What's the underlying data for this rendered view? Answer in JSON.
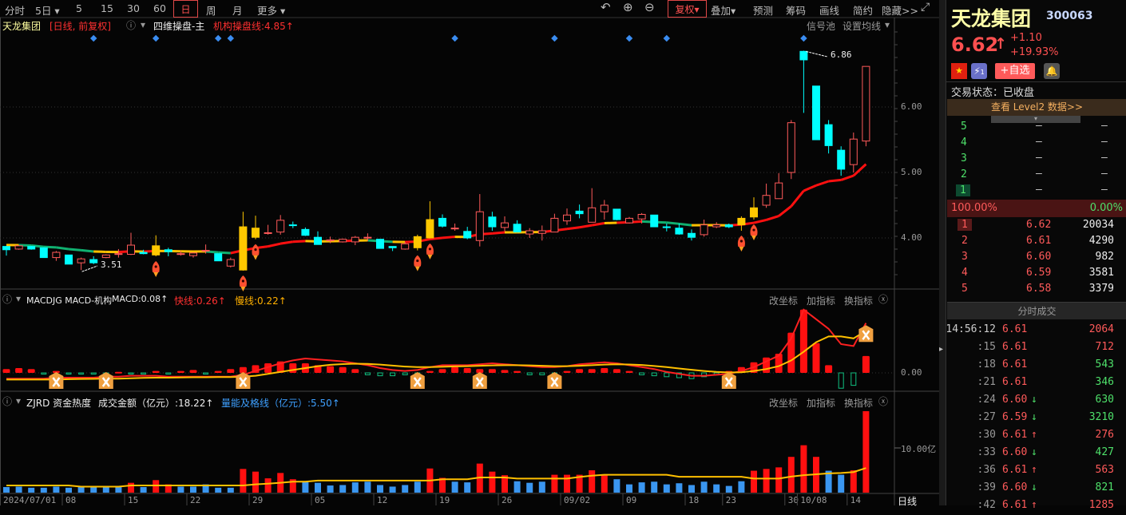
{
  "toolbar": {
    "periods": [
      "分时",
      "5日",
      "5",
      "15",
      "30",
      "60",
      "日",
      "周",
      "月",
      "更多"
    ],
    "selected_period": "日",
    "right": [
      "复权",
      "叠加",
      "预测",
      "筹码",
      "画线",
      "简约",
      "隐藏>>"
    ]
  },
  "main_header": {
    "stock": "天龙集团",
    "mode": "[日线, 前复权]",
    "indicator": "四维操盘-主",
    "line_label": "机构操盘线:4.85↑",
    "signal_pool": "信号池",
    "set_ma": "设置均线"
  },
  "macd_header": {
    "name": "MACDJG MACD-机构",
    "macd": "MACD:0.08↑",
    "fast": "快线:0.26↑",
    "slow": "慢线:0.22↑"
  },
  "vol_header": {
    "name": "ZJRD 资金热度",
    "amount": "成交金额（亿元）:18.22↑",
    "line": "量能及格线（亿元）:5.50↑"
  },
  "panel_actions": [
    "改坐标",
    "加指标",
    "换指标"
  ],
  "axis": {
    "price_ticks": [
      "6.00",
      "5.00",
      "4.00"
    ],
    "macd_tick": "0.00",
    "vol_tick": "10.00亿",
    "period_label": "日线"
  },
  "annotations": {
    "high": "6.86",
    "low": "3.51"
  },
  "colors": {
    "up": "#ff5a5a",
    "down": "#00ffff",
    "signal": "#ffc800",
    "vol_down": "#3a96f0",
    "vol_up": "#ff1010"
  },
  "chart_data": [
    {
      "type": "candlestick",
      "title": "天龙集团 日线",
      "ylim": [
        3.4,
        7.0
      ],
      "ohlc": [
        [
          3.87,
          3.82,
          3.88,
          3.73
        ],
        [
          3.83,
          3.88,
          3.89,
          3.82
        ],
        [
          3.87,
          3.83,
          3.88,
          3.82
        ],
        [
          3.85,
          3.7,
          3.86,
          3.7
        ],
        [
          3.7,
          3.78,
          3.8,
          3.65
        ],
        [
          3.74,
          3.6,
          3.74,
          3.6
        ],
        [
          3.62,
          3.68,
          3.7,
          3.51
        ],
        [
          3.67,
          3.62,
          3.72,
          3.6
        ],
        [
          3.7,
          3.74,
          3.75,
          3.69
        ],
        [
          3.75,
          3.76,
          3.83,
          3.7
        ],
        [
          3.75,
          3.89,
          4.08,
          3.74
        ],
        [
          3.78,
          3.76,
          3.82,
          3.75
        ],
        [
          3.74,
          3.88,
          4.04,
          3.72
        ],
        [
          3.82,
          3.79,
          3.85,
          3.72
        ],
        [
          3.75,
          3.76,
          3.8,
          3.73
        ],
        [
          3.73,
          3.77,
          3.78,
          3.7
        ],
        [
          3.8,
          3.81,
          3.9,
          3.76
        ],
        [
          3.76,
          3.65,
          3.76,
          3.65
        ],
        [
          3.57,
          3.67,
          3.7,
          3.55
        ],
        [
          3.51,
          4.17,
          4.4,
          3.5
        ],
        [
          4.01,
          4.15,
          4.34,
          3.98
        ],
        [
          4.07,
          4.08,
          4.2,
          4.05
        ],
        [
          4.09,
          4.27,
          4.35,
          4.05
        ],
        [
          4.2,
          4.19,
          4.25,
          4.15
        ],
        [
          4.13,
          4.04,
          4.16,
          4.03
        ],
        [
          4.01,
          3.9,
          4.1,
          3.9
        ],
        [
          3.96,
          3.97,
          4.02,
          3.92
        ],
        [
          3.94,
          3.98,
          3.99,
          3.93
        ],
        [
          3.94,
          4.01,
          4.03,
          3.89
        ],
        [
          4.0,
          4.01,
          4.07,
          3.95
        ],
        [
          3.98,
          3.84,
          3.98,
          3.84
        ],
        [
          3.87,
          3.85,
          3.87,
          3.8
        ],
        [
          3.83,
          3.91,
          3.94,
          3.82
        ],
        [
          3.85,
          4.02,
          4.05,
          3.81
        ],
        [
          4.0,
          4.28,
          4.56,
          3.99
        ],
        [
          4.3,
          4.18,
          4.36,
          4.16
        ],
        [
          4.14,
          4.15,
          4.22,
          4.11
        ],
        [
          4.1,
          4.0,
          4.17,
          3.98
        ],
        [
          3.96,
          4.4,
          4.67,
          3.87
        ],
        [
          4.32,
          4.17,
          4.4,
          4.11
        ],
        [
          4.16,
          4.23,
          4.33,
          4.1
        ],
        [
          4.21,
          4.09,
          4.27,
          4.09
        ],
        [
          4.06,
          4.11,
          4.15,
          4.0
        ],
        [
          4.07,
          4.11,
          4.19,
          3.96
        ],
        [
          4.09,
          4.3,
          4.37,
          4.09
        ],
        [
          4.26,
          4.35,
          4.45,
          4.2
        ],
        [
          4.41,
          4.37,
          4.51,
          4.3
        ],
        [
          4.24,
          4.46,
          4.76,
          4.24
        ],
        [
          4.4,
          4.5,
          4.58,
          4.28
        ],
        [
          4.44,
          4.28,
          4.44,
          4.27
        ],
        [
          4.23,
          4.3,
          4.32,
          4.22
        ],
        [
          4.29,
          4.36,
          4.38,
          4.22
        ],
        [
          4.35,
          4.17,
          4.35,
          4.17
        ],
        [
          4.17,
          4.16,
          4.22,
          4.1
        ],
        [
          4.15,
          4.06,
          4.22,
          4.05
        ],
        [
          4.07,
          4.01,
          4.13,
          3.96
        ],
        [
          4.05,
          4.2,
          4.28,
          4.02
        ],
        [
          4.17,
          4.2,
          4.24,
          4.15
        ],
        [
          4.2,
          4.17,
          4.22,
          4.15
        ],
        [
          4.2,
          4.3,
          4.33,
          4.11
        ],
        [
          4.32,
          4.46,
          4.62,
          4.28
        ],
        [
          4.5,
          4.65,
          4.83,
          4.46
        ],
        [
          4.6,
          4.84,
          4.99,
          4.6
        ],
        [
          5.0,
          5.76,
          5.8,
          4.9
        ],
        [
          6.85,
          6.72,
          6.86,
          5.91
        ],
        [
          6.32,
          5.5,
          6.32,
          5.5
        ],
        [
          5.73,
          5.41,
          5.8,
          5.29
        ],
        [
          5.34,
          5.05,
          5.4,
          4.95
        ],
        [
          5.12,
          5.51,
          5.61,
          5.0
        ],
        [
          5.48,
          6.62,
          6.62,
          5.4
        ]
      ],
      "signal_candles": [
        12,
        19,
        20,
        33,
        34,
        59,
        60
      ],
      "rocket_markers": [
        12,
        19,
        20,
        33,
        34,
        59,
        60
      ],
      "diamond_markers": [
        7,
        12,
        17,
        18,
        36,
        44,
        50,
        53,
        64
      ],
      "high_index": 64,
      "low_index": 6,
      "x_labels": [
        {
          "i": 0,
          "t": "2024/07/01"
        },
        {
          "i": 5,
          "t": "08"
        },
        {
          "i": 10,
          "t": "15"
        },
        {
          "i": 15,
          "t": "22"
        },
        {
          "i": 20,
          "t": "29"
        },
        {
          "i": 25,
          "t": "05"
        },
        {
          "i": 30,
          "t": "12"
        },
        {
          "i": 35,
          "t": "19"
        },
        {
          "i": 40,
          "t": "26"
        },
        {
          "i": 45,
          "t": "09/02"
        },
        {
          "i": 50,
          "t": "09"
        },
        {
          "i": 55,
          "t": "18"
        },
        {
          "i": 58,
          "t": "23"
        },
        {
          "i": 63,
          "t": "30"
        },
        {
          "i": 64,
          "t": "10/08"
        },
        {
          "i": 68,
          "t": "14"
        }
      ]
    },
    {
      "type": "bar+line",
      "title": "MACD-机构",
      "unit": "0.01",
      "hist": [
        2,
        2.5,
        2,
        -0.5,
        1,
        -0.5,
        -0.5,
        -0.5,
        -0.3,
        0.5,
        -0.5,
        -0.5,
        1,
        -0.5,
        1,
        1.5,
        -0.5,
        1,
        2,
        3,
        4,
        5,
        6,
        5,
        5,
        4,
        3.5,
        3,
        2,
        -1,
        -1.5,
        -1.5,
        -1,
        -1,
        1,
        2,
        3,
        2.5,
        2,
        2,
        1.5,
        1,
        -1,
        -1,
        -0.5,
        1,
        2,
        2,
        2.5,
        2,
        1,
        -1,
        -1.5,
        -2,
        -2.5,
        -3,
        -2,
        -1,
        1,
        3,
        5.5,
        8,
        10,
        21,
        33,
        15.5,
        4,
        -8,
        -6.5,
        8.8
      ],
      "fast": [
        -3,
        -3,
        -3,
        -3,
        -2.5,
        -2.5,
        -2.5,
        -2.5,
        -2,
        -2,
        -1.5,
        -1.5,
        -1.5,
        -2,
        -2,
        -2,
        -2,
        -2,
        -2,
        -1,
        1,
        3,
        5,
        6.5,
        7.5,
        7,
        6.5,
        6,
        5,
        4,
        2.5,
        1.5,
        1,
        1.5,
        3,
        4,
        4,
        4,
        4.5,
        5,
        4.5,
        4,
        3.5,
        3,
        3,
        3.5,
        4.5,
        5,
        5.5,
        5,
        4,
        3,
        2,
        0.5,
        -0.5,
        -1.5,
        -1.5,
        -1,
        -0.5,
        1,
        3,
        6,
        9,
        18,
        33,
        28,
        23,
        15,
        14,
        26
      ],
      "slow": [
        -3.5,
        -3.5,
        -3.5,
        -3.5,
        -3.5,
        -3.3,
        -3.2,
        -3.1,
        -3,
        -3,
        -2.8,
        -2.6,
        -2.5,
        -2.5,
        -2.4,
        -2.3,
        -2.3,
        -2.2,
        -2.2,
        -2,
        -1.5,
        -0.5,
        0.5,
        1.5,
        2.5,
        3.5,
        4.2,
        4.6,
        4.8,
        4.7,
        4.3,
        3.8,
        3.3,
        3,
        3,
        3.2,
        3.4,
        3.5,
        3.7,
        3.9,
        4,
        4,
        3.9,
        3.7,
        3.5,
        3.5,
        3.7,
        4,
        4.3,
        4.5,
        4.4,
        4.1,
        3.6,
        3,
        2.3,
        1.6,
        1,
        0.5,
        0.2,
        0.3,
        1,
        2,
        3.5,
        6.5,
        11,
        16,
        19,
        19,
        18,
        22
      ],
      "cross_markers": [
        4,
        8,
        19,
        33,
        38,
        44,
        58,
        69
      ]
    },
    {
      "type": "bar+line",
      "title": "资金热度",
      "unit": "亿元",
      "amount": [
        1.25,
        1.35,
        1.1,
        1.1,
        1.35,
        1.1,
        1.35,
        1.25,
        1.25,
        1.35,
        2.2,
        1.25,
        2.8,
        1.85,
        1.35,
        1.35,
        1.85,
        1.1,
        1.1,
        5.3,
        4.7,
        3.2,
        4.4,
        3.0,
        2.4,
        2.2,
        1.6,
        1.7,
        2.3,
        2.45,
        1.7,
        1.35,
        1.7,
        2.45,
        5.4,
        3.3,
        2.45,
        2.3,
        6.5,
        4.7,
        3.9,
        2.55,
        2.2,
        2.45,
        4.0,
        4.0,
        4.0,
        5.0,
        4.1,
        3.0,
        1.85,
        2.3,
        2.45,
        1.85,
        2.1,
        1.7,
        2.45,
        1.85,
        1.5,
        2.55,
        4.9,
        5.3,
        5.65,
        8.0,
        10.6,
        8.0,
        4.9,
        4.0,
        5.0,
        18.22
      ],
      "up": [
        0,
        0,
        0,
        0,
        0,
        0,
        0,
        0,
        0,
        0,
        1,
        0,
        1,
        1,
        0,
        0,
        0,
        0,
        0,
        1,
        1,
        1,
        1,
        1,
        0,
        0,
        0,
        0,
        0,
        0,
        0,
        0,
        0,
        0,
        1,
        1,
        0,
        0,
        1,
        1,
        1,
        0,
        0,
        0,
        1,
        1,
        1,
        1,
        1,
        0,
        0,
        0,
        0,
        0,
        0,
        0,
        0,
        0,
        0,
        0,
        1,
        1,
        1,
        1,
        1,
        1,
        0,
        0,
        1,
        1
      ],
      "pass_line": [
        1.6,
        1.6,
        1.6,
        1.6,
        1.6,
        1.6,
        1.35,
        1.35,
        1.35,
        1.35,
        1.6,
        1.6,
        1.6,
        1.6,
        1.6,
        1.6,
        1.6,
        1.6,
        1.6,
        1.6,
        1.85,
        2.0,
        2.2,
        2.45,
        2.45,
        2.7,
        2.7,
        2.7,
        2.7,
        2.7,
        2.7,
        2.7,
        2.7,
        2.7,
        2.7,
        3.0,
        3.0,
        3.0,
        3.4,
        3.4,
        3.4,
        3.15,
        3.15,
        3.15,
        3.15,
        3.15,
        3.5,
        3.8,
        4.0,
        4.0,
        4.0,
        4.0,
        4.0,
        4.0,
        3.55,
        3.55,
        3.55,
        3.55,
        3.55,
        3.55,
        3.15,
        3.15,
        3.15,
        3.6,
        3.9,
        4.1,
        4.3,
        4.4,
        4.6,
        5.5
      ]
    }
  ],
  "quote": {
    "name": "天龙集团",
    "code": "300063",
    "price": "6.62",
    "arrow": "↑",
    "change": "+1.10",
    "pct": "+19.93%",
    "watch_button": "+自选",
    "flash_badge": "1",
    "status": "交易状态：已收盘",
    "level2": "查看 Level2 数据>>",
    "sell": [
      {
        "n": "5",
        "p": "—",
        "v": "—"
      },
      {
        "n": "4",
        "p": "—",
        "v": "—"
      },
      {
        "n": "3",
        "p": "—",
        "v": "—"
      },
      {
        "n": "2",
        "p": "—",
        "v": "—"
      },
      {
        "n": "1",
        "p": "—",
        "v": "—"
      }
    ],
    "ratio_buy": "100.00%",
    "ratio_sell": "0.00%",
    "buy": [
      {
        "n": "1",
        "p": "6.62",
        "v": "20034"
      },
      {
        "n": "2",
        "p": "6.61",
        "v": "4290"
      },
      {
        "n": "3",
        "p": "6.60",
        "v": "982"
      },
      {
        "n": "4",
        "p": "6.59",
        "v": "3581"
      },
      {
        "n": "5",
        "p": "6.58",
        "v": "3379"
      }
    ],
    "ticks_title": "分时成交",
    "ticks": [
      {
        "t": "14:56:12",
        "p": "6.61",
        "d": "",
        "v": "2064",
        "c": "r"
      },
      {
        "t": ":15",
        "p": "6.61",
        "d": "",
        "v": "712",
        "c": "r"
      },
      {
        "t": ":18",
        "p": "6.61",
        "d": "",
        "v": "543",
        "c": "g"
      },
      {
        "t": ":21",
        "p": "6.61",
        "d": "",
        "v": "346",
        "c": "g"
      },
      {
        "t": ":24",
        "p": "6.60",
        "d": "↓",
        "v": "630",
        "c": "g"
      },
      {
        "t": ":27",
        "p": "6.59",
        "d": "↓",
        "v": "3210",
        "c": "g"
      },
      {
        "t": ":30",
        "p": "6.61",
        "d": "↑",
        "v": "276",
        "c": "r"
      },
      {
        "t": ":33",
        "p": "6.60",
        "d": "↓",
        "v": "427",
        "c": "g"
      },
      {
        "t": ":36",
        "p": "6.61",
        "d": "↑",
        "v": "563",
        "c": "r"
      },
      {
        "t": ":39",
        "p": "6.60",
        "d": "↓",
        "v": "821",
        "c": "g"
      },
      {
        "t": ":42",
        "p": "6.61",
        "d": "↑",
        "v": "1285",
        "c": "r"
      }
    ]
  }
}
